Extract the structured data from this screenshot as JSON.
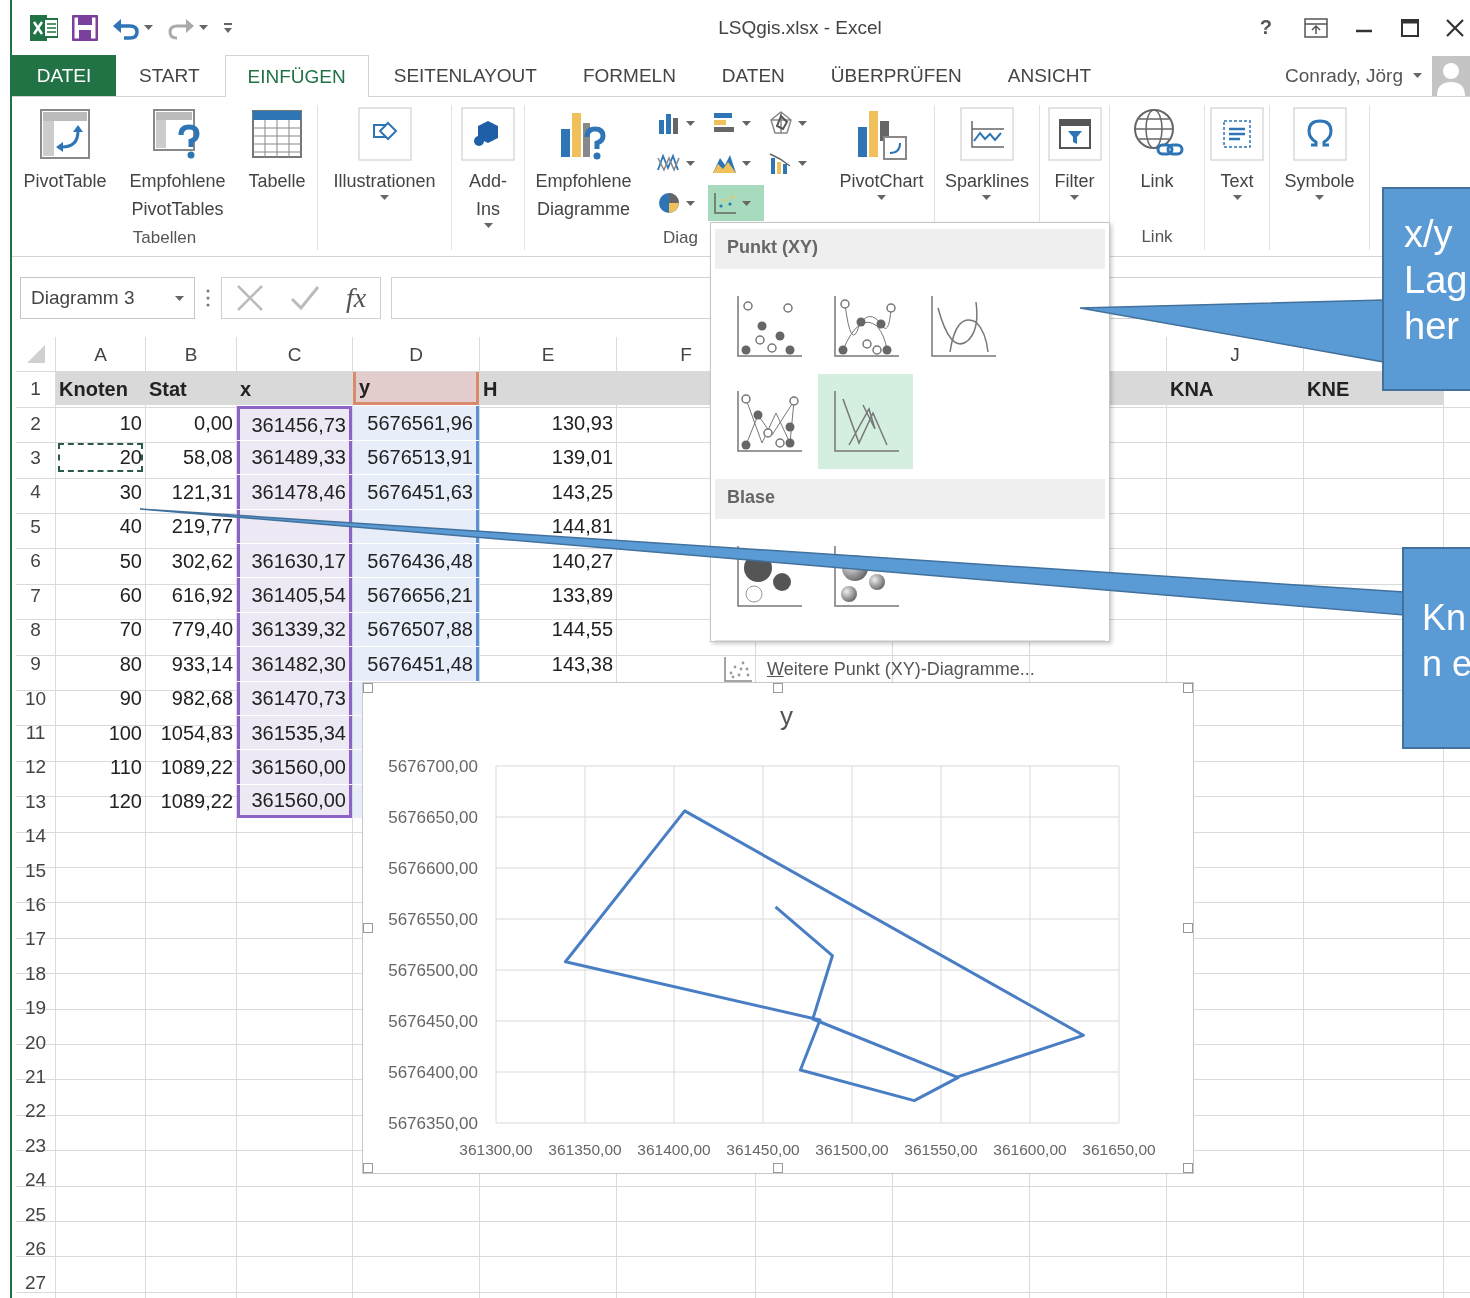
{
  "window": {
    "title": "LSQgis.xlsx - Excel",
    "help": "?"
  },
  "tabs": [
    {
      "label": "DATEI",
      "kind": "file",
      "selected": false
    },
    {
      "label": "START",
      "kind": "tab",
      "selected": false
    },
    {
      "label": "EINFÜGEN",
      "kind": "tab",
      "selected": true
    },
    {
      "label": "SEITENLAYOUT",
      "kind": "tab",
      "selected": false
    },
    {
      "label": "FORMELN",
      "kind": "tab",
      "selected": false
    },
    {
      "label": "DATEN",
      "kind": "tab",
      "selected": false
    },
    {
      "label": "ÜBERPRÜFEN",
      "kind": "tab",
      "selected": false
    },
    {
      "label": "ANSICHT",
      "kind": "tab",
      "selected": false
    }
  ],
  "user": {
    "name": "Conrady, Jörg"
  },
  "ribbon": {
    "groups": [
      {
        "label": "Tabellen",
        "items": [
          {
            "label": "PivotTable",
            "dropdown": false
          },
          {
            "label": "Empfohlene\nPivotTables",
            "dropdown": false
          },
          {
            "label": "Tabelle",
            "dropdown": false
          }
        ]
      },
      {
        "items": [
          {
            "label": "Illustrationen",
            "dropdown": true
          }
        ]
      },
      {
        "items": [
          {
            "label": "Add-\nIns",
            "dropdown": true
          }
        ]
      },
      {
        "label": "Diag",
        "items": [
          {
            "label": "Empfohlene\nDiagramme",
            "dropdown": false
          },
          {
            "label": "PivotChart",
            "dropdown": true
          }
        ],
        "chart_types": [
          {
            "selected": false
          },
          {
            "selected": false
          },
          {
            "selected": false
          },
          {
            "selected": false
          },
          {
            "selected": false
          },
          {
            "selected": false
          },
          {
            "selected": false
          },
          {
            "selected": true
          }
        ]
      },
      {
        "items": [
          {
            "label": "Sparklines",
            "dropdown": true
          }
        ]
      },
      {
        "items": [
          {
            "label": "Filter",
            "dropdown": true
          }
        ]
      },
      {
        "label": "Link",
        "items": [
          {
            "label": "Link",
            "dropdown": false
          }
        ]
      },
      {
        "items": [
          {
            "label": "Text",
            "dropdown": true
          }
        ]
      },
      {
        "items": [
          {
            "label": "Symbole",
            "dropdown": true
          }
        ]
      }
    ]
  },
  "formula_bar": {
    "name_box": "Diagramm 3",
    "function_label": "fx"
  },
  "sheet": {
    "columns": [
      {
        "label": "A",
        "kind": "plain"
      },
      {
        "label": "B",
        "kind": "plain"
      },
      {
        "label": "C",
        "kind": "x-values"
      },
      {
        "label": "D",
        "kind": "y-values"
      },
      {
        "label": "E",
        "kind": "plain"
      },
      {
        "label": "F",
        "kind": "plain"
      },
      {
        "kind": "plain"
      },
      {
        "kind": "plain"
      },
      {
        "kind": "plain"
      },
      {
        "label": "J",
        "kind": "plain"
      },
      {
        "kind": "plain"
      }
    ],
    "rows": [
      {
        "number": "1",
        "kind": "header",
        "in_range": false,
        "cells": [
          {
            "text": "Knoten",
            "copied": false
          },
          {
            "text": "Stat",
            "copied": false
          },
          {
            "text": "x",
            "copied": false
          },
          {
            "text": "y",
            "copied": false
          },
          {
            "text": "H",
            "copied": false
          },
          {
            "copied": false
          },
          {},
          {},
          {
            "copied": false
          },
          {
            "text": "KNA",
            "copied": false
          },
          {
            "text": "KNE",
            "copied": false
          }
        ]
      },
      {
        "number": "2",
        "kind": "data",
        "in_range": true,
        "cells": [
          {
            "text": "10",
            "copied": false
          },
          {
            "text": "0,00",
            "copied": false
          },
          {
            "text": "361456,73",
            "copied": false
          },
          {
            "text": "5676561,96",
            "copied": false
          },
          {
            "text": "130,93",
            "copied": false
          }
        ]
      },
      {
        "number": "3",
        "kind": "data",
        "in_range": true,
        "cells": [
          {
            "text": "20",
            "copied": true
          },
          {
            "text": "58,08",
            "copied": false
          },
          {
            "text": "361489,33",
            "copied": false
          },
          {
            "text": "5676513,91",
            "copied": false
          },
          {
            "text": "139,01",
            "copied": false
          }
        ]
      },
      {
        "number": "4",
        "kind": "data",
        "in_range": true,
        "cells": [
          {
            "text": "30",
            "copied": false
          },
          {
            "text": "121,31",
            "copied": false
          },
          {
            "text": "361478,46",
            "copied": false
          },
          {
            "text": "5676451,63",
            "copied": false
          },
          {
            "text": "143,25",
            "copied": false
          }
        ]
      },
      {
        "number": "5",
        "kind": "data",
        "in_range": true,
        "cells": [
          {
            "text": "40",
            "copied": false
          },
          {
            "text": "219,77",
            "copied": false
          },
          {
            "copied": false
          },
          {
            "copied": false
          },
          {
            "text": "144,81",
            "copied": false
          }
        ]
      },
      {
        "number": "6",
        "kind": "data",
        "in_range": true,
        "cells": [
          {
            "text": "50",
            "copied": false
          },
          {
            "text": "302,62",
            "copied": false
          },
          {
            "text": "361630,17",
            "copied": false
          },
          {
            "text": "5676436,48",
            "copied": false
          },
          {
            "text": "140,27",
            "copied": false
          }
        ]
      },
      {
        "number": "7",
        "kind": "data",
        "in_range": true,
        "cells": [
          {
            "text": "60",
            "copied": false
          },
          {
            "text": "616,92",
            "copied": false
          },
          {
            "text": "361405,54",
            "copied": false
          },
          {
            "text": "5676656,21",
            "copied": false
          },
          {
            "text": "133,89",
            "copied": false
          }
        ]
      },
      {
        "number": "8",
        "kind": "data",
        "in_range": true,
        "cells": [
          {
            "text": "70",
            "copied": false
          },
          {
            "text": "779,40",
            "copied": false
          },
          {
            "text": "361339,32",
            "copied": false
          },
          {
            "text": "5676507,88",
            "copied": false
          },
          {
            "text": "144,55",
            "copied": false
          }
        ]
      },
      {
        "number": "9",
        "kind": "data",
        "in_range": true,
        "cells": [
          {
            "text": "80",
            "copied": false
          },
          {
            "text": "933,14",
            "copied": false
          },
          {
            "text": "361482,30",
            "copied": false
          },
          {
            "text": "5676451,48",
            "copied": false
          },
          {
            "text": "143,38",
            "copied": false
          }
        ]
      },
      {
        "number": "10",
        "kind": "data",
        "in_range": true,
        "cells": [
          {
            "text": "90",
            "copied": false
          },
          {
            "text": "982,68",
            "copied": false
          },
          {
            "text": "361470,73",
            "copied": false
          }
        ]
      },
      {
        "number": "11",
        "kind": "data",
        "in_range": true,
        "cells": [
          {
            "text": "100",
            "copied": false
          },
          {
            "text": "1054,83",
            "copied": false
          },
          {
            "text": "361535,34",
            "copied": false
          }
        ]
      },
      {
        "number": "12",
        "kind": "data",
        "in_range": true,
        "cells": [
          {
            "text": "110",
            "copied": false
          },
          {
            "text": "1089,22",
            "copied": false
          },
          {
            "text": "361560,00",
            "copied": false
          }
        ]
      },
      {
        "number": "13",
        "kind": "data",
        "in_range": true,
        "cells": [
          {
            "text": "120",
            "copied": false
          },
          {
            "text": "1089,22",
            "copied": false
          },
          {
            "text": "361560,00",
            "copied": false
          }
        ]
      },
      {
        "number": "14",
        "kind": "data"
      },
      {
        "number": "15",
        "kind": "data"
      },
      {
        "number": "16",
        "kind": "data"
      },
      {
        "number": "17",
        "kind": "data"
      },
      {
        "number": "18",
        "kind": "data"
      },
      {
        "number": "19",
        "kind": "data"
      },
      {
        "number": "20",
        "kind": "data"
      },
      {
        "number": "21",
        "kind": "data"
      },
      {
        "number": "22",
        "kind": "data"
      },
      {
        "number": "23",
        "kind": "data"
      },
      {
        "number": "24",
        "kind": "data"
      },
      {
        "number": "25",
        "kind": "data"
      },
      {
        "number": "26",
        "kind": "data"
      },
      {
        "number": "27",
        "kind": "data"
      }
    ]
  },
  "chart": {
    "selected": true,
    "chart_data": {
      "type": "line",
      "title": "y",
      "grid": true,
      "x": [
        361457,
        361489,
        361478,
        361559,
        361630,
        361406,
        361339,
        361482,
        361471,
        361535,
        361560,
        361560
      ],
      "series": [
        {
          "color": "#4a7ec4",
          "values": [
            5676562,
            5676514,
            5676452,
            5676395,
            5676436,
            5676656,
            5676508,
            5676451,
            5676402,
            5676372,
            5676395,
            5676395
          ]
        }
      ],
      "xlim": [
        361300,
        361650
      ],
      "ylim": [
        5676350,
        5676700
      ],
      "xticks": [
        {
          "value": 361300,
          "label": "361300,00"
        },
        {
          "value": 361350,
          "label": "361350,00"
        },
        {
          "value": 361400,
          "label": "361400,00"
        },
        {
          "value": 361450,
          "label": "361450,00"
        },
        {
          "value": 361500,
          "label": "361500,00"
        },
        {
          "value": 361550,
          "label": "361550,00"
        },
        {
          "value": 361600,
          "label": "361600,00"
        },
        {
          "value": 361650,
          "label": "361650,00"
        }
      ],
      "yticks": [
        {
          "value": 5676350,
          "label": "5676350,00"
        },
        {
          "value": 5676400,
          "label": "5676400,00"
        },
        {
          "value": 5676450,
          "label": "5676450,00"
        },
        {
          "value": 5676500,
          "label": "5676500,00"
        },
        {
          "value": 5676550,
          "label": "5676550,00"
        },
        {
          "value": 5676600,
          "label": "5676600,00"
        },
        {
          "value": 5676650,
          "label": "5676650,00"
        },
        {
          "value": 5676700,
          "label": "5676700,00"
        }
      ]
    }
  },
  "chart_menu": {
    "sections": [
      {
        "title": "Punkt (XY)",
        "options": [
          {
            "selected": false
          },
          {
            "selected": false
          },
          {
            "selected": false
          },
          {
            "selected": false
          },
          {
            "selected": true
          }
        ]
      },
      {
        "title": "Blase",
        "options": [
          {
            "selected": false
          },
          {
            "selected": false
          }
        ]
      }
    ],
    "more": "Weitere Punkt (XY)-Diagramme..."
  },
  "callouts": [
    {
      "text": "x/y\nLag\nher"
    },
    {
      "text": "Kn\nn e"
    }
  ]
}
